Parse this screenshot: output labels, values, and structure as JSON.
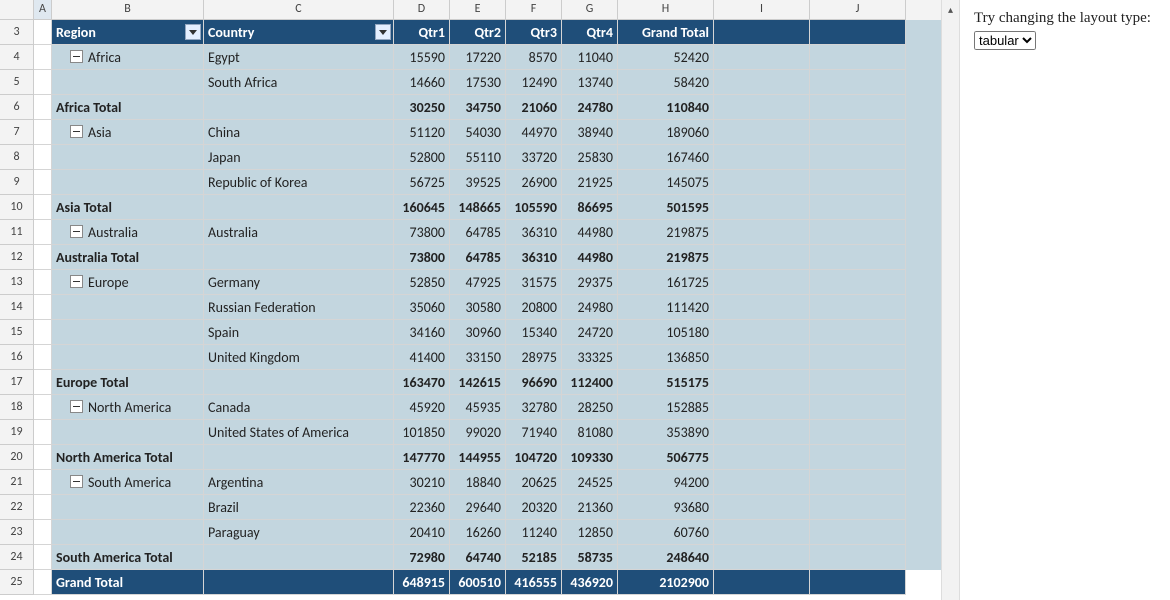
{
  "colHeaders": [
    "A",
    "B",
    "C",
    "D",
    "E",
    "F",
    "G",
    "H",
    "I",
    "J"
  ],
  "startRow": 3,
  "header": {
    "region": "Region",
    "country": "Country",
    "q1": "Qtr1",
    "q2": "Qtr2",
    "q3": "Qtr3",
    "q4": "Qtr4",
    "total": "Grand Total"
  },
  "rows": [
    {
      "type": "data",
      "region": "Africa",
      "country": "Egypt",
      "q": [
        15590,
        17220,
        8570,
        11040
      ],
      "t": 52420
    },
    {
      "type": "data",
      "region": "",
      "country": "South Africa",
      "q": [
        14660,
        17530,
        12490,
        13740
      ],
      "t": 58420
    },
    {
      "type": "sub",
      "label": "Africa Total",
      "q": [
        30250,
        34750,
        21060,
        24780
      ],
      "t": 110840
    },
    {
      "type": "data",
      "region": "Asia",
      "country": "China",
      "q": [
        51120,
        54030,
        44970,
        38940
      ],
      "t": 189060
    },
    {
      "type": "data",
      "region": "",
      "country": "Japan",
      "q": [
        52800,
        55110,
        33720,
        25830
      ],
      "t": 167460
    },
    {
      "type": "data",
      "region": "",
      "country": "Republic of Korea",
      "q": [
        56725,
        39525,
        26900,
        21925
      ],
      "t": 145075
    },
    {
      "type": "sub",
      "label": "Asia Total",
      "q": [
        160645,
        148665,
        105590,
        86695
      ],
      "t": 501595
    },
    {
      "type": "data",
      "region": "Australia",
      "country": "Australia",
      "q": [
        73800,
        64785,
        36310,
        44980
      ],
      "t": 219875
    },
    {
      "type": "sub",
      "label": "Australia Total",
      "q": [
        73800,
        64785,
        36310,
        44980
      ],
      "t": 219875
    },
    {
      "type": "data",
      "region": "Europe",
      "country": "Germany",
      "q": [
        52850,
        47925,
        31575,
        29375
      ],
      "t": 161725
    },
    {
      "type": "data",
      "region": "",
      "country": "Russian Federation",
      "q": [
        35060,
        30580,
        20800,
        24980
      ],
      "t": 111420
    },
    {
      "type": "data",
      "region": "",
      "country": "Spain",
      "q": [
        34160,
        30960,
        15340,
        24720
      ],
      "t": 105180
    },
    {
      "type": "data",
      "region": "",
      "country": "United Kingdom",
      "q": [
        41400,
        33150,
        28975,
        33325
      ],
      "t": 136850
    },
    {
      "type": "sub",
      "label": "Europe Total",
      "q": [
        163470,
        142615,
        96690,
        112400
      ],
      "t": 515175
    },
    {
      "type": "data",
      "region": "North America",
      "country": "Canada",
      "q": [
        45920,
        45935,
        32780,
        28250
      ],
      "t": 152885
    },
    {
      "type": "data",
      "region": "",
      "country": "United States of America",
      "q": [
        101850,
        99020,
        71940,
        81080
      ],
      "t": 353890
    },
    {
      "type": "sub",
      "label": "North America Total",
      "q": [
        147770,
        144955,
        104720,
        109330
      ],
      "t": 506775
    },
    {
      "type": "data",
      "region": "South America",
      "country": "Argentina",
      "q": [
        30210,
        18840,
        20625,
        24525
      ],
      "t": 94200
    },
    {
      "type": "data",
      "region": "",
      "country": "Brazil",
      "q": [
        22360,
        29640,
        20320,
        21360
      ],
      "t": 93680
    },
    {
      "type": "data",
      "region": "",
      "country": "Paraguay",
      "q": [
        20410,
        16260,
        11240,
        12850
      ],
      "t": 60760
    },
    {
      "type": "sub",
      "label": "South America Total",
      "q": [
        72980,
        64740,
        52185,
        58735
      ],
      "t": 248640
    },
    {
      "type": "grand",
      "label": "Grand Total",
      "q": [
        648915,
        600510,
        416555,
        436920
      ],
      "t": 2102900
    }
  ],
  "sidebar": {
    "prompt": "Try changing the layout type:",
    "selected": "tabular"
  }
}
